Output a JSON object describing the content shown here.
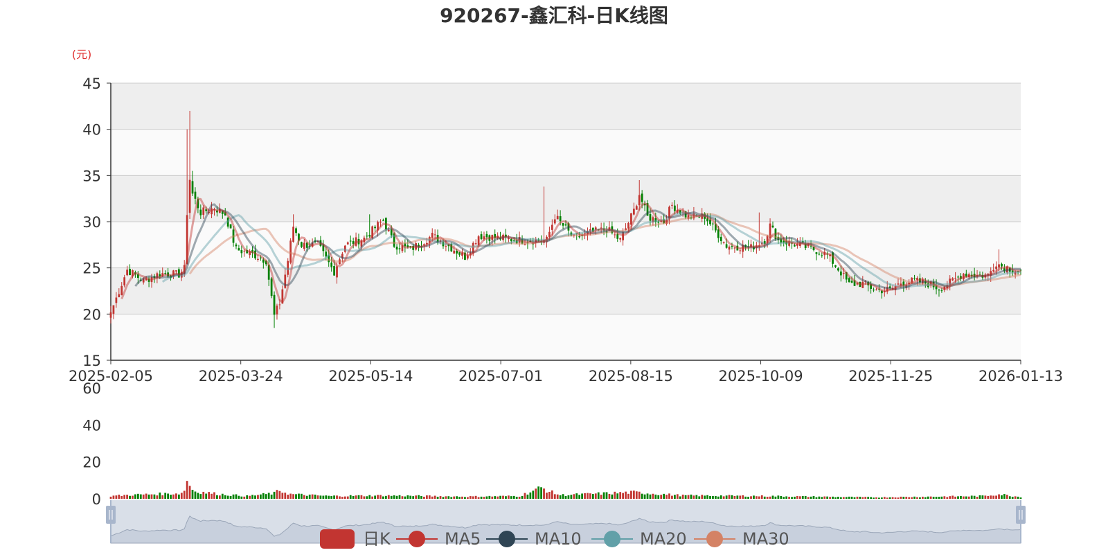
{
  "chart_data": {
    "type": "candlestick",
    "title": "920267-鑫汇科-日K线图",
    "price_unit": "(元)",
    "ylim": [
      15,
      45
    ],
    "yticks": [
      15,
      20,
      25,
      30,
      35,
      40,
      45
    ],
    "volume_ylim": [
      0,
      60
    ],
    "volume_yticks": [
      0,
      20,
      40,
      60
    ],
    "xticks": [
      "2025-02-05",
      "2025-03-24",
      "2025-05-14",
      "2025-07-01",
      "2025-08-15",
      "2025-10-09",
      "2025-11-25",
      "2026-01-13"
    ],
    "price_keypoints": [
      {
        "i": 0,
        "close": 20.2
      },
      {
        "i": 3,
        "close": 22.5
      },
      {
        "i": 6,
        "close": 24.8
      },
      {
        "i": 12,
        "close": 23.6
      },
      {
        "i": 18,
        "close": 24.4
      },
      {
        "i": 25,
        "close": 24.3
      },
      {
        "i": 27,
        "close": 24.9
      },
      {
        "i": 28,
        "close": 31.0
      },
      {
        "i": 29,
        "close": 34.6
      },
      {
        "i": 30,
        "close": 33.0
      },
      {
        "i": 33,
        "close": 31.0
      },
      {
        "i": 38,
        "close": 31.5
      },
      {
        "i": 42,
        "close": 30.8
      },
      {
        "i": 46,
        "close": 27.0
      },
      {
        "i": 52,
        "close": 26.5
      },
      {
        "i": 57,
        "close": 25.8
      },
      {
        "i": 60,
        "close": 19.8
      },
      {
        "i": 62,
        "close": 21.2
      },
      {
        "i": 65,
        "close": 25.8
      },
      {
        "i": 67,
        "close": 29.5
      },
      {
        "i": 70,
        "close": 27.5
      },
      {
        "i": 76,
        "close": 27.5
      },
      {
        "i": 80,
        "close": 25.5
      },
      {
        "i": 82,
        "close": 24.6
      },
      {
        "i": 86,
        "close": 27.5
      },
      {
        "i": 93,
        "close": 28.2
      },
      {
        "i": 100,
        "close": 30.2
      },
      {
        "i": 104,
        "close": 27.5
      },
      {
        "i": 110,
        "close": 27.0
      },
      {
        "i": 118,
        "close": 28.5
      },
      {
        "i": 126,
        "close": 27.0
      },
      {
        "i": 130,
        "close": 26.2
      },
      {
        "i": 135,
        "close": 28.5
      },
      {
        "i": 150,
        "close": 28.0
      },
      {
        "i": 160,
        "close": 28.0
      },
      {
        "i": 163,
        "close": 30.6
      },
      {
        "i": 170,
        "close": 28.2
      },
      {
        "i": 176,
        "close": 28.8
      },
      {
        "i": 182,
        "close": 29.2
      },
      {
        "i": 187,
        "close": 28.0
      },
      {
        "i": 192,
        "close": 31.2
      },
      {
        "i": 194,
        "close": 33.0
      },
      {
        "i": 197,
        "close": 30.5
      },
      {
        "i": 203,
        "close": 30.0
      },
      {
        "i": 206,
        "close": 31.8
      },
      {
        "i": 212,
        "close": 30.5
      },
      {
        "i": 218,
        "close": 30.6
      },
      {
        "i": 222,
        "close": 29.0
      },
      {
        "i": 226,
        "close": 27.4
      },
      {
        "i": 235,
        "close": 27.2
      },
      {
        "i": 240,
        "close": 28.0
      },
      {
        "i": 242,
        "close": 29.6
      },
      {
        "i": 245,
        "close": 28.0
      },
      {
        "i": 252,
        "close": 27.5
      },
      {
        "i": 258,
        "close": 27.0
      },
      {
        "i": 263,
        "close": 26.4
      },
      {
        "i": 268,
        "close": 24.5
      },
      {
        "i": 271,
        "close": 23.2
      },
      {
        "i": 276,
        "close": 23.3
      },
      {
        "i": 281,
        "close": 22.6
      },
      {
        "i": 286,
        "close": 22.6
      },
      {
        "i": 290,
        "close": 23.4
      },
      {
        "i": 295,
        "close": 23.6
      },
      {
        "i": 300,
        "close": 23.3
      },
      {
        "i": 304,
        "close": 22.8
      },
      {
        "i": 308,
        "close": 23.4
      },
      {
        "i": 313,
        "close": 24.4
      },
      {
        "i": 318,
        "close": 24.2
      },
      {
        "i": 322,
        "close": 24.2
      },
      {
        "i": 325,
        "close": 25.6
      },
      {
        "i": 327,
        "close": 25.2
      },
      {
        "i": 332,
        "close": 24.8
      },
      {
        "i": 334,
        "close": 24.6
      }
    ],
    "spikes": [
      {
        "i": 28,
        "high": 40.0
      },
      {
        "i": 29,
        "high": 42.0
      },
      {
        "i": 30,
        "high": 35.5
      },
      {
        "i": 60,
        "low": 18.5
      },
      {
        "i": 67,
        "high": 30.8
      },
      {
        "i": 95,
        "high": 30.8
      },
      {
        "i": 159,
        "high": 33.8
      },
      {
        "i": 194,
        "high": 34.5
      },
      {
        "i": 238,
        "high": 31.0
      },
      {
        "i": 326,
        "high": 27.0
      }
    ],
    "volume_keypoints": [
      {
        "i": 0,
        "v": 1.5
      },
      {
        "i": 5,
        "v": 2.0
      },
      {
        "i": 26,
        "v": 3.0
      },
      {
        "i": 27,
        "v": 5.0
      },
      {
        "i": 28,
        "v": 10.0
      },
      {
        "i": 29,
        "v": 7.0
      },
      {
        "i": 31,
        "v": 4.0
      },
      {
        "i": 40,
        "v": 2.5
      },
      {
        "i": 50,
        "v": 1.5
      },
      {
        "i": 60,
        "v": 3.0
      },
      {
        "i": 62,
        "v": 4.5
      },
      {
        "i": 66,
        "v": 2.5
      },
      {
        "i": 80,
        "v": 1.5
      },
      {
        "i": 100,
        "v": 1.8
      },
      {
        "i": 130,
        "v": 1.2
      },
      {
        "i": 150,
        "v": 1.5
      },
      {
        "i": 158,
        "v": 6.0
      },
      {
        "i": 161,
        "v": 4.0
      },
      {
        "i": 165,
        "v": 2.0
      },
      {
        "i": 192,
        "v": 3.5
      },
      {
        "i": 210,
        "v": 1.8
      },
      {
        "i": 240,
        "v": 1.5
      },
      {
        "i": 280,
        "v": 0.8
      },
      {
        "i": 320,
        "v": 1.5
      },
      {
        "i": 326,
        "v": 2.5
      },
      {
        "i": 334,
        "v": 1.0
      }
    ],
    "series_count": 335,
    "legend": [
      "日K",
      "MA5",
      "MA10",
      "MA20",
      "MA30"
    ],
    "colors": {
      "up": "#c23531",
      "down": "#008000",
      "ma5": "#c23531",
      "ma10": "#2f4554",
      "ma20": "#61a0a8",
      "ma30": "#d48265",
      "grid_band": "#eeeeee",
      "grid_band_alt": "#fafafa",
      "grid_line": "#cccccc",
      "axis": "#333333",
      "title": "#333333",
      "unit": "#e03030",
      "slider_bg": "#d5dbe6",
      "slider_handle": "#a8b6cc"
    }
  }
}
